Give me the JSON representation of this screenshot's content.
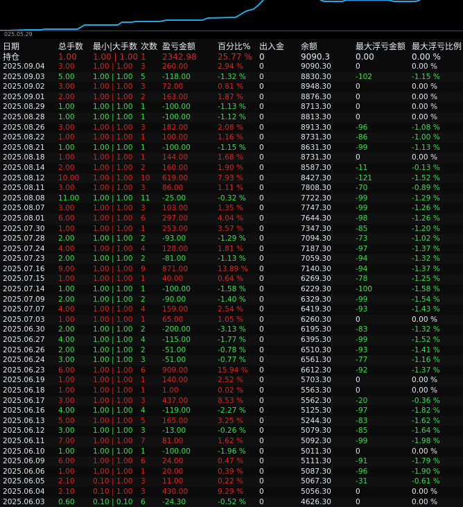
{
  "chart": {
    "date_label": "025.05.29",
    "line_color": "#1ea9e6"
  },
  "colors": {
    "profit": "#e0201c",
    "loss": "#33e046",
    "neutral": "#dfe3e8"
  },
  "headers": [
    "日期",
    "总手数",
    "最小|大手数",
    "次数",
    "盈亏金额",
    "百分比%",
    "出入金",
    "余额",
    "最大浮亏金额",
    "最大浮亏比例"
  ],
  "holding": {
    "date": "持仓",
    "lots": "1.00",
    "minmax": "1.00 | 1.00",
    "count": "1",
    "pnl": "2342.98",
    "pct": "25.77 %",
    "flow": "0",
    "balance": "9090.3",
    "maxloss": "0.00",
    "maxlosspct": "0.00 %",
    "sign": "pos"
  },
  "rows": [
    {
      "date": "2025.09.04",
      "lots": "3.00",
      "minmax": "1.00 | 1.00",
      "count": "3",
      "pnl": "260.00",
      "pct": "2.94 %",
      "flow": "0",
      "balance": "9090.30",
      "maxloss": "0",
      "maxlosspct": "0.00 %",
      "sign": "pos"
    },
    {
      "date": "2025.09.03",
      "lots": "5.00",
      "minmax": "1.00 | 1.00",
      "count": "5",
      "pnl": "-118.00",
      "pct": "-1.32 %",
      "flow": "0",
      "balance": "8830.30",
      "maxloss": "-102",
      "maxlosspct": "-1.15 %",
      "sign": "neg"
    },
    {
      "date": "2025.09.02",
      "lots": "3.00",
      "minmax": "1.00 | 1.00",
      "count": "3",
      "pnl": "72.00",
      "pct": "0.81 %",
      "flow": "0",
      "balance": "8948.30",
      "maxloss": "0",
      "maxlosspct": "0.00 %",
      "sign": "pos"
    },
    {
      "date": "2025.09.01",
      "lots": "2.00",
      "minmax": "1.00 | 1.00",
      "count": "2",
      "pnl": "163.00",
      "pct": "1.87 %",
      "flow": "0",
      "balance": "8876.30",
      "maxloss": "0",
      "maxlosspct": "0.00 %",
      "sign": "pos"
    },
    {
      "date": "2025.08.29",
      "lots": "1.00",
      "minmax": "1.00 | 1.00",
      "count": "1",
      "pnl": "-100.00",
      "pct": "-1.13 %",
      "flow": "0",
      "balance": "8713.30",
      "maxloss": "0",
      "maxlosspct": "0.00 %",
      "sign": "neg"
    },
    {
      "date": "2025.08.28",
      "lots": "1.00",
      "minmax": "1.00 | 1.00",
      "count": "1",
      "pnl": "-100.00",
      "pct": "-1.12 %",
      "flow": "0",
      "balance": "8813.30",
      "maxloss": "0",
      "maxlosspct": "0.00 %",
      "sign": "neg"
    },
    {
      "date": "2025.08.26",
      "lots": "3.00",
      "minmax": "1.00 | 1.00",
      "count": "3",
      "pnl": "182.00",
      "pct": "2.08 %",
      "flow": "0",
      "balance": "8913.30",
      "maxloss": "-96",
      "maxlosspct": "-1.08 %",
      "sign": "pos"
    },
    {
      "date": "2025.08.22",
      "lots": "1.00",
      "minmax": "1.00 | 1.00",
      "count": "1",
      "pnl": "100.00",
      "pct": "1.16 %",
      "flow": "0",
      "balance": "8731.30",
      "maxloss": "-86",
      "maxlosspct": "-1.00 %",
      "sign": "pos"
    },
    {
      "date": "2025.08.21",
      "lots": "1.00",
      "minmax": "1.00 | 1.00",
      "count": "1",
      "pnl": "-100.00",
      "pct": "-1.15 %",
      "flow": "0",
      "balance": "8631.30",
      "maxloss": "-99",
      "maxlosspct": "-1.13 %",
      "sign": "neg"
    },
    {
      "date": "2025.08.18",
      "lots": "1.00",
      "minmax": "1.00 | 1.00",
      "count": "1",
      "pnl": "144.00",
      "pct": "1.68 %",
      "flow": "0",
      "balance": "8731.30",
      "maxloss": "0",
      "maxlosspct": "0.00 %",
      "sign": "pos"
    },
    {
      "date": "2025.08.14",
      "lots": "2.00",
      "minmax": "1.00 | 1.00",
      "count": "2",
      "pnl": "160.00",
      "pct": "1.90 %",
      "flow": "0",
      "balance": "8587.30",
      "maxloss": "-11",
      "maxlosspct": "-0.13 %",
      "sign": "pos"
    },
    {
      "date": "2025.08.12",
      "lots": "10.00",
      "minmax": "1.00 | 1.00",
      "count": "10",
      "pnl": "619.00",
      "pct": "7.93 %",
      "flow": "0",
      "balance": "8427.30",
      "maxloss": "-121",
      "maxlosspct": "-1.52 %",
      "sign": "pos"
    },
    {
      "date": "2025.08.11",
      "lots": "3.00",
      "minmax": "1.00 | 1.00",
      "count": "3",
      "pnl": "86.00",
      "pct": "1.11 %",
      "flow": "0",
      "balance": "7808.30",
      "maxloss": "-70",
      "maxlosspct": "-0.89 %",
      "sign": "pos"
    },
    {
      "date": "2025.08.08",
      "lots": "11.00",
      "minmax": "1.00 | 1.00",
      "count": "11",
      "pnl": "-25.00",
      "pct": "-0.32 %",
      "flow": "0",
      "balance": "7722.30",
      "maxloss": "-99",
      "maxlosspct": "-1.29 %",
      "sign": "neg"
    },
    {
      "date": "2025.08.07",
      "lots": "3.00",
      "minmax": "1.00 | 1.00",
      "count": "3",
      "pnl": "103.00",
      "pct": "1.35 %",
      "flow": "0",
      "balance": "7747.30",
      "maxloss": "-99",
      "maxlosspct": "-1.26 %",
      "sign": "pos"
    },
    {
      "date": "2025.08.01",
      "lots": "6.00",
      "minmax": "1.00 | 1.00",
      "count": "6",
      "pnl": "297.00",
      "pct": "4.04 %",
      "flow": "0",
      "balance": "7644.30",
      "maxloss": "-98",
      "maxlosspct": "-1.26 %",
      "sign": "pos"
    },
    {
      "date": "2025.07.30",
      "lots": "1.00",
      "minmax": "1.00 | 1.00",
      "count": "1",
      "pnl": "253.00",
      "pct": "3.57 %",
      "flow": "0",
      "balance": "7347.30",
      "maxloss": "-85",
      "maxlosspct": "-1.20 %",
      "sign": "pos"
    },
    {
      "date": "2025.07.28",
      "lots": "2.00",
      "minmax": "1.00 | 1.00",
      "count": "2",
      "pnl": "-93.00",
      "pct": "-1.29 %",
      "flow": "0",
      "balance": "7094.30",
      "maxloss": "-73",
      "maxlosspct": "-1.02 %",
      "sign": "neg"
    },
    {
      "date": "2025.07.24",
      "lots": "4.00",
      "minmax": "1.00 | 1.00",
      "count": "4",
      "pnl": "128.00",
      "pct": "1.81 %",
      "flow": "0",
      "balance": "7187.30",
      "maxloss": "-97",
      "maxlosspct": "-1.37 %",
      "sign": "pos"
    },
    {
      "date": "2025.07.23",
      "lots": "2.00",
      "minmax": "1.00 | 1.00",
      "count": "2",
      "pnl": "-81.00",
      "pct": "-1.13 %",
      "flow": "0",
      "balance": "7059.30",
      "maxloss": "-94",
      "maxlosspct": "-1.32 %",
      "sign": "neg"
    },
    {
      "date": "2025.07.16",
      "lots": "9.00",
      "minmax": "1.00 | 1.00",
      "count": "9",
      "pnl": "871.00",
      "pct": "13.89 %",
      "flow": "0",
      "balance": "7140.30",
      "maxloss": "-94",
      "maxlosspct": "-1.37 %",
      "sign": "pos"
    },
    {
      "date": "2025.07.15",
      "lots": "1.00",
      "minmax": "1.00 | 1.00",
      "count": "1",
      "pnl": "40.00",
      "pct": "0.64 %",
      "flow": "0",
      "balance": "6269.30",
      "maxloss": "-78",
      "maxlosspct": "-1.25 %",
      "sign": "pos"
    },
    {
      "date": "2025.07.14",
      "lots": "1.00",
      "minmax": "1.00 | 1.00",
      "count": "1",
      "pnl": "-100.00",
      "pct": "-1.58 %",
      "flow": "0",
      "balance": "6229.30",
      "maxloss": "-100",
      "maxlosspct": "-1.58 %",
      "sign": "neg"
    },
    {
      "date": "2025.07.09",
      "lots": "2.00",
      "minmax": "1.00 | 1.00",
      "count": "2",
      "pnl": "-90.00",
      "pct": "-1.40 %",
      "flow": "0",
      "balance": "6329.30",
      "maxloss": "-99",
      "maxlosspct": "-1.54 %",
      "sign": "neg"
    },
    {
      "date": "2025.07.07",
      "lots": "4.00",
      "minmax": "1.00 | 1.00",
      "count": "4",
      "pnl": "159.00",
      "pct": "2.54 %",
      "flow": "0",
      "balance": "6419.30",
      "maxloss": "-93",
      "maxlosspct": "-1.43 %",
      "sign": "pos"
    },
    {
      "date": "2025.07.03",
      "lots": "1.00",
      "minmax": "1.00 | 1.00",
      "count": "1",
      "pnl": "65.00",
      "pct": "1.05 %",
      "flow": "0",
      "balance": "6260.30",
      "maxloss": "0",
      "maxlosspct": "0.00 %",
      "sign": "pos"
    },
    {
      "date": "2025.06.30",
      "lots": "2.00",
      "minmax": "1.00 | 1.00",
      "count": "2",
      "pnl": "-200.00",
      "pct": "-3.13 %",
      "flow": "0",
      "balance": "6195.30",
      "maxloss": "-83",
      "maxlosspct": "-1.32 %",
      "sign": "neg"
    },
    {
      "date": "2025.06.27",
      "lots": "4.00",
      "minmax": "1.00 | 1.00",
      "count": "4",
      "pnl": "-115.00",
      "pct": "-1.77 %",
      "flow": "0",
      "balance": "6395.30",
      "maxloss": "-99",
      "maxlosspct": "-1.52 %",
      "sign": "neg"
    },
    {
      "date": "2025.06.26",
      "lots": "2.00",
      "minmax": "1.00 | 1.00",
      "count": "2",
      "pnl": "-51.00",
      "pct": "-0.78 %",
      "flow": "0",
      "balance": "6510.30",
      "maxloss": "-93",
      "maxlosspct": "-1.41 %",
      "sign": "neg"
    },
    {
      "date": "2025.06.24",
      "lots": "3.00",
      "minmax": "1.00 | 1.00",
      "count": "3",
      "pnl": "-51.00",
      "pct": "-0.77 %",
      "flow": "0",
      "balance": "6561.30",
      "maxloss": "-77",
      "maxlosspct": "-1.16 %",
      "sign": "neg"
    },
    {
      "date": "2025.06.23",
      "lots": "6.00",
      "minmax": "1.00 | 1.00",
      "count": "6",
      "pnl": "909.00",
      "pct": "15.94 %",
      "flow": "0",
      "balance": "6612.30",
      "maxloss": "-92",
      "maxlosspct": "-1.37 %",
      "sign": "pos"
    },
    {
      "date": "2025.06.19",
      "lots": "1.00",
      "minmax": "1.00 | 1.00",
      "count": "1",
      "pnl": "140.00",
      "pct": "2.52 %",
      "flow": "0",
      "balance": "5703.30",
      "maxloss": "0",
      "maxlosspct": "0.00 %",
      "sign": "pos"
    },
    {
      "date": "2025.06.18",
      "lots": "1.00",
      "minmax": "1.00 | 1.00",
      "count": "1",
      "pnl": "1.00",
      "pct": "0.02 %",
      "flow": "0",
      "balance": "5563.30",
      "maxloss": "0",
      "maxlosspct": "0.00 %",
      "sign": "pos"
    },
    {
      "date": "2025.06.17",
      "lots": "3.00",
      "minmax": "1.00 | 1.00",
      "count": "3",
      "pnl": "437.00",
      "pct": "8.53 %",
      "flow": "0",
      "balance": "5562.30",
      "maxloss": "-20",
      "maxlosspct": "-0.36 %",
      "sign": "pos"
    },
    {
      "date": "2025.06.16",
      "lots": "4.00",
      "minmax": "1.00 | 1.00",
      "count": "4",
      "pnl": "-119.00",
      "pct": "-2.27 %",
      "flow": "0",
      "balance": "5125.30",
      "maxloss": "-97",
      "maxlosspct": "-1.82 %",
      "sign": "neg"
    },
    {
      "date": "2025.06.13",
      "lots": "5.00",
      "minmax": "1.00 | 1.00",
      "count": "5",
      "pnl": "165.00",
      "pct": "3.25 %",
      "flow": "0",
      "balance": "5244.30",
      "maxloss": "-83",
      "maxlosspct": "-1.62 %",
      "sign": "pos"
    },
    {
      "date": "2025.06.12",
      "lots": "3.00",
      "minmax": "1.00 | 1.00",
      "count": "3",
      "pnl": "-13.00",
      "pct": "-0.26 %",
      "flow": "0",
      "balance": "5079.30",
      "maxloss": "-85",
      "maxlosspct": "-1.64 %",
      "sign": "neg"
    },
    {
      "date": "2025.06.11",
      "lots": "7.00",
      "minmax": "1.00 | 1.00",
      "count": "7",
      "pnl": "81.00",
      "pct": "1.62 %",
      "flow": "0",
      "balance": "5092.30",
      "maxloss": "-99",
      "maxlosspct": "-1.98 %",
      "sign": "pos"
    },
    {
      "date": "2025.06.10",
      "lots": "1.00",
      "minmax": "1.00 | 1.00",
      "count": "1",
      "pnl": "-100.00",
      "pct": "-1.96 %",
      "flow": "0",
      "balance": "5011.30",
      "maxloss": "0",
      "maxlosspct": "0.00 %",
      "sign": "neg"
    },
    {
      "date": "2025.06.09",
      "lots": "6.00",
      "minmax": "1.00 | 1.00",
      "count": "6",
      "pnl": "24.00",
      "pct": "0.47 %",
      "flow": "0",
      "balance": "5111.30",
      "maxloss": "-91",
      "maxlosspct": "-1.79 %",
      "sign": "pos"
    },
    {
      "date": "2025.06.06",
      "lots": "1.00",
      "minmax": "1.00 | 1.00",
      "count": "1",
      "pnl": "20.00",
      "pct": "0.39 %",
      "flow": "0",
      "balance": "5087.30",
      "maxloss": "-96",
      "maxlosspct": "-1.90 %",
      "sign": "pos"
    },
    {
      "date": "2025.06.05",
      "lots": "2.10",
      "minmax": "0.10 | 1.00",
      "count": "3",
      "pnl": "11.00",
      "pct": "0.22 %",
      "flow": "0",
      "balance": "5067.30",
      "maxloss": "-31",
      "maxlosspct": "-0.61 %",
      "sign": "pos"
    },
    {
      "date": "2025.06.04",
      "lots": "2.10",
      "minmax": "0.10 | 1.00",
      "count": "3",
      "pnl": "430.00",
      "pct": "9.29 %",
      "flow": "0",
      "balance": "5056.30",
      "maxloss": "0",
      "maxlosspct": "0.00 %",
      "sign": "pos"
    },
    {
      "date": "2025.06.03",
      "lots": "0.60",
      "minmax": "0.10 | 0.10",
      "count": "6",
      "pnl": "-24.30",
      "pct": "-0.52 %",
      "flow": "0",
      "balance": "4626.30",
      "maxloss": "0",
      "maxlosspct": "0.00 %",
      "sign": "neg"
    }
  ]
}
